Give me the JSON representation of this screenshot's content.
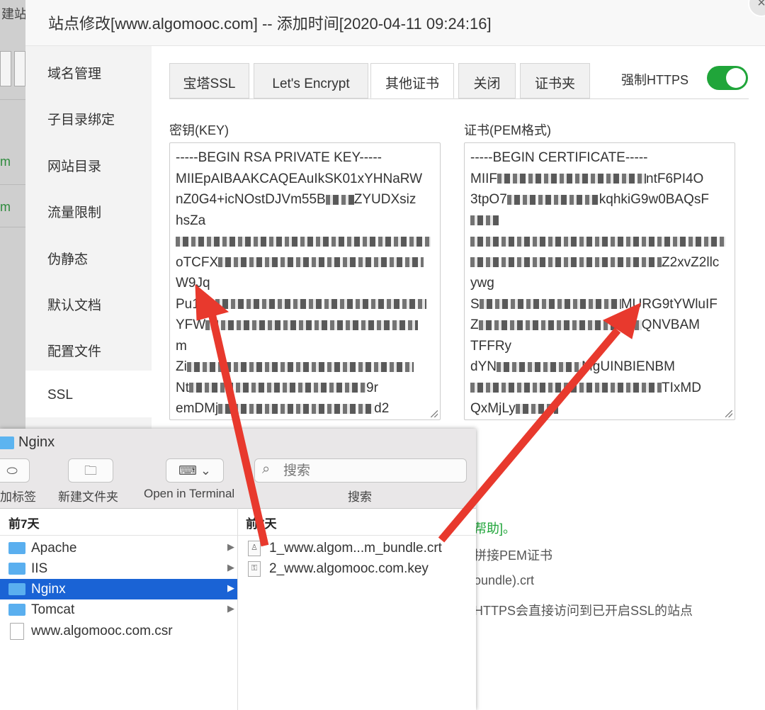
{
  "background": {
    "title_fragment": "建站",
    "green_labels": [
      "m",
      "m"
    ]
  },
  "modal": {
    "title": "站点修改[www.algomooc.com] -- 添加时间[2020-04-11 09:24:16]",
    "close_symbol": "×"
  },
  "menu": {
    "items": [
      {
        "label": "域名管理"
      },
      {
        "label": "子目录绑定"
      },
      {
        "label": "网站目录"
      },
      {
        "label": "流量限制"
      },
      {
        "label": "伪静态"
      },
      {
        "label": "默认文档"
      },
      {
        "label": "配置文件"
      },
      {
        "label": "SSL"
      }
    ]
  },
  "tabs": [
    {
      "label": "宝塔SSL"
    },
    {
      "label": "Let's Encrypt"
    },
    {
      "label": "其他证书"
    },
    {
      "label": "关闭"
    },
    {
      "label": "证书夹"
    }
  ],
  "https": {
    "label": "强制HTTPS",
    "enabled": true
  },
  "key_field": {
    "label": "密钥(KEY)",
    "lines": [
      "-----BEGIN RSA PRIVATE KEY-----",
      "MIIEpAIBAAKCAQEAuIkSK01xYHNaRW",
      "nZ0G4+icNOstDJVm55B",
      "hsZa",
      "",
      "oTCFX",
      "W9Jq",
      "Pu1",
      "YFW",
      "m",
      "Zi",
      "Nt",
      "emDMj"
    ]
  },
  "cert_field": {
    "label": "证书(PEM格式)",
    "lines": [
      "-----BEGIN CERTIFICATE-----",
      "MIIF",
      "3tpO7",
      "",
      "",
      "",
      "ywg",
      "S",
      "Z",
      "TFFRy",
      "dYN",
      "",
      "QxMjLy"
    ]
  },
  "key_tail": [
    "ntF6PI4O",
    "kqhkiG9w0BAQsF",
    "Z2xvZ2llc",
    "MURG9tYWluIF",
    "QNVBAM",
    "MgUINBIENBM",
    "TIxMD",
    "9r",
    "d2"
  ],
  "help": {
    "line1": "帮助]。",
    "line2": "拼接PEM证书",
    "line3": "oundle).crt",
    "line4": "HTTPS会直接访问到已开启SSL的站点"
  },
  "finder": {
    "title": "Nginx",
    "toolbar": {
      "tag_label": "加标签",
      "new_folder_label": "新建文件夹",
      "terminal_label": "Open in Terminal",
      "search_label": "搜索",
      "search_placeholder": "搜索"
    },
    "left_header": "前7天",
    "right_header": "前7天",
    "left_items": [
      {
        "name": "Apache",
        "type": "folder",
        "selected": false
      },
      {
        "name": "IIS",
        "type": "folder",
        "selected": false
      },
      {
        "name": "Nginx",
        "type": "folder",
        "selected": true
      },
      {
        "name": "Tomcat",
        "type": "folder",
        "selected": false
      },
      {
        "name": "www.algomooc.com.csr",
        "type": "file",
        "selected": false
      }
    ],
    "right_items": [
      {
        "name": "1_www.algom...m_bundle.crt"
      },
      {
        "name": "2_www.algomooc.com.key"
      }
    ]
  },
  "colors": {
    "accent_green": "#20a53a",
    "arrow_red": "#e8392d",
    "finder_selection": "#1a63d5"
  }
}
